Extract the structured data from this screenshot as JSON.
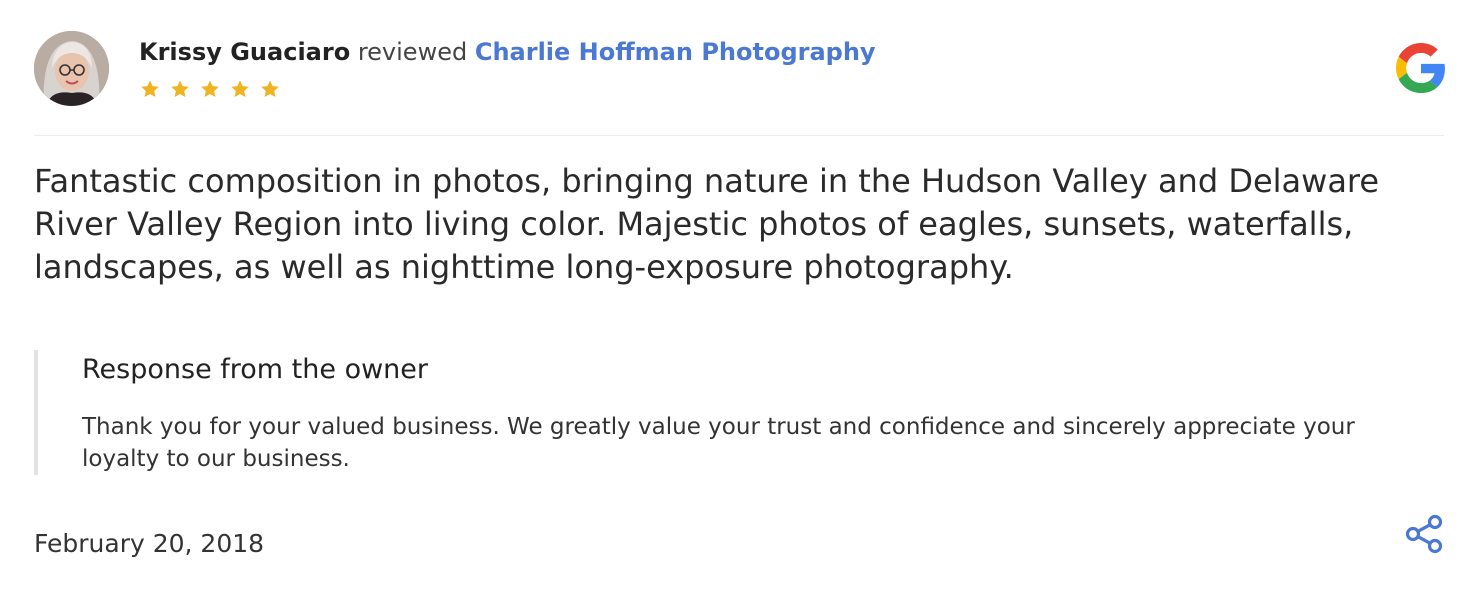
{
  "review": {
    "reviewer_name": "Krissy Guaciaro",
    "reviewed_word": "reviewed",
    "business_name": "Charlie Hoffman Photography",
    "rating": 5,
    "star_color": "#f0b322",
    "text": "Fantastic composition in photos, bringing nature in the Hudson Valley and Delaware River Valley Region into living color. Majestic photos of eagles, sunsets, waterfalls, landscapes, as well as nighttime long-exposure photography.",
    "date": "February 20, 2018"
  },
  "owner_response": {
    "title": "Response from the owner",
    "text": "Thank you for your valued business. We greatly value your trust and confidence and sincerely appreciate your loyalty to our business."
  },
  "icons": {
    "source_logo": "google-logo-icon",
    "share": "share-icon",
    "star": "star-icon"
  },
  "colors": {
    "link": "#4a78d2",
    "share": "#4a78d2",
    "google_blue": "#4285F4",
    "google_red": "#EA4335",
    "google_yellow": "#FBBC05",
    "google_green": "#34A853"
  }
}
